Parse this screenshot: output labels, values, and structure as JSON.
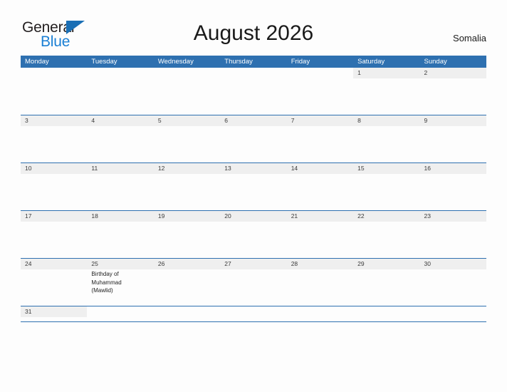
{
  "header": {
    "logo": {
      "primary_text": "General",
      "secondary_text": "Blue",
      "triangle_icon": "triangle-icon",
      "primary_color": "#231f20",
      "secondary_color": "#1a7fd4"
    },
    "title": "August 2026",
    "country": "Somalia"
  },
  "theme": {
    "header_blue": "#2e70b0",
    "band_gray": "#efefef",
    "page_background": "#fdfdfd",
    "text_color": "#3a3a3a"
  },
  "calendar": {
    "weekdays": [
      "Monday",
      "Tuesday",
      "Wednesday",
      "Thursday",
      "Friday",
      "Saturday",
      "Sunday"
    ],
    "weeks": [
      [
        {
          "day": "",
          "events": []
        },
        {
          "day": "",
          "events": []
        },
        {
          "day": "",
          "events": []
        },
        {
          "day": "",
          "events": []
        },
        {
          "day": "",
          "events": []
        },
        {
          "day": "1",
          "events": []
        },
        {
          "day": "2",
          "events": []
        }
      ],
      [
        {
          "day": "3",
          "events": []
        },
        {
          "day": "4",
          "events": []
        },
        {
          "day": "5",
          "events": []
        },
        {
          "day": "6",
          "events": []
        },
        {
          "day": "7",
          "events": []
        },
        {
          "day": "8",
          "events": []
        },
        {
          "day": "9",
          "events": []
        }
      ],
      [
        {
          "day": "10",
          "events": []
        },
        {
          "day": "11",
          "events": []
        },
        {
          "day": "12",
          "events": []
        },
        {
          "day": "13",
          "events": []
        },
        {
          "day": "14",
          "events": []
        },
        {
          "day": "15",
          "events": []
        },
        {
          "day": "16",
          "events": []
        }
      ],
      [
        {
          "day": "17",
          "events": []
        },
        {
          "day": "18",
          "events": []
        },
        {
          "day": "19",
          "events": []
        },
        {
          "day": "20",
          "events": []
        },
        {
          "day": "21",
          "events": []
        },
        {
          "day": "22",
          "events": []
        },
        {
          "day": "23",
          "events": []
        }
      ],
      [
        {
          "day": "24",
          "events": []
        },
        {
          "day": "25",
          "events": [
            "Birthday of",
            "Muhammad",
            "(Mawlid)"
          ]
        },
        {
          "day": "26",
          "events": []
        },
        {
          "day": "27",
          "events": []
        },
        {
          "day": "28",
          "events": []
        },
        {
          "day": "29",
          "events": []
        },
        {
          "day": "30",
          "events": []
        }
      ],
      [
        {
          "day": "31",
          "events": []
        },
        {
          "day": "",
          "events": []
        },
        {
          "day": "",
          "events": []
        },
        {
          "day": "",
          "events": []
        },
        {
          "day": "",
          "events": []
        },
        {
          "day": "",
          "events": []
        },
        {
          "day": "",
          "events": []
        }
      ]
    ]
  }
}
